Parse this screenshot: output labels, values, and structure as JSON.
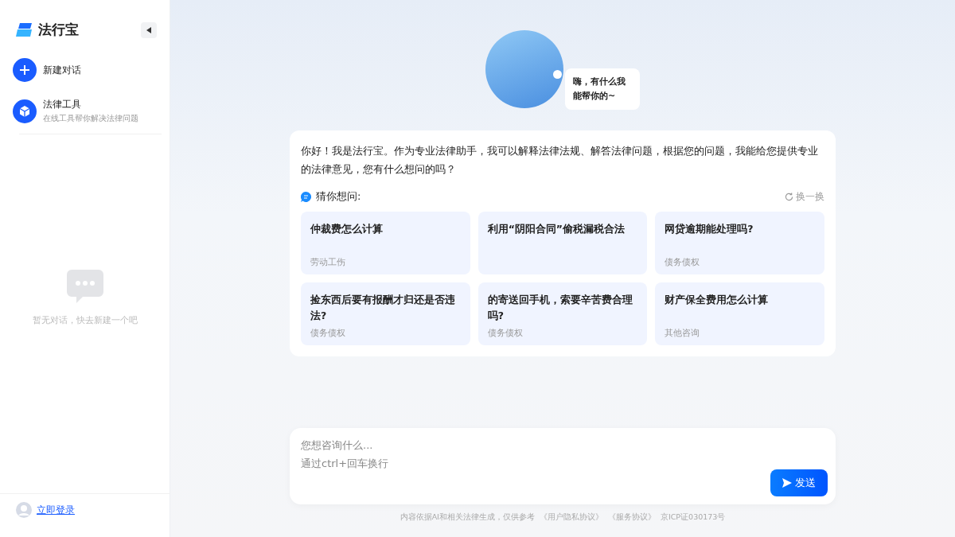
{
  "sidebar": {
    "brand": "法行宝",
    "items": [
      {
        "kind": "new",
        "title": "新建对话"
      },
      {
        "kind": "tool",
        "title": "法律工具",
        "subtitle": "在线工具帮你解决法律问题"
      }
    ],
    "empty_text": "暂无对话，快去新建一个吧",
    "login": "立即登录"
  },
  "greeting": {
    "bubble": "嗨，有什么我能帮你的~"
  },
  "intro": {
    "text": "你好！我是法行宝。作为专业法律助手，我可以解释法律法规、解答法律问题，根据您的问题，我能给您提供专业的法律意见，您有什么想问的吗？",
    "suggest_label": "猜你想问:",
    "refresh": "换一换",
    "questions": [
      {
        "title": "仲裁费怎么计算",
        "category": "劳动工伤"
      },
      {
        "title": "利用“阴阳合同”偷税漏税合法"
      },
      {
        "title": "网贷逾期能处理吗?",
        "category": "债务债权"
      },
      {
        "title": "捡东西后要有报酬才归还是否违法?",
        "category": "债务债权"
      },
      {
        "title": "的寄送回手机，索要辛苦费合理吗?",
        "category": "债务债权"
      },
      {
        "title": "财产保全费用怎么计算",
        "category": "其他咨询"
      }
    ]
  },
  "composer": {
    "placeholder": "您想咨询什么...\n通过ctrl+回车换行",
    "send": "发送"
  },
  "footer": {
    "notice": "内容依据AI和相关法律生成，仅供参考",
    "links": [
      "《用户隐私协议》",
      "《服务协议》"
    ],
    "icp": "京ICP证030173号"
  }
}
